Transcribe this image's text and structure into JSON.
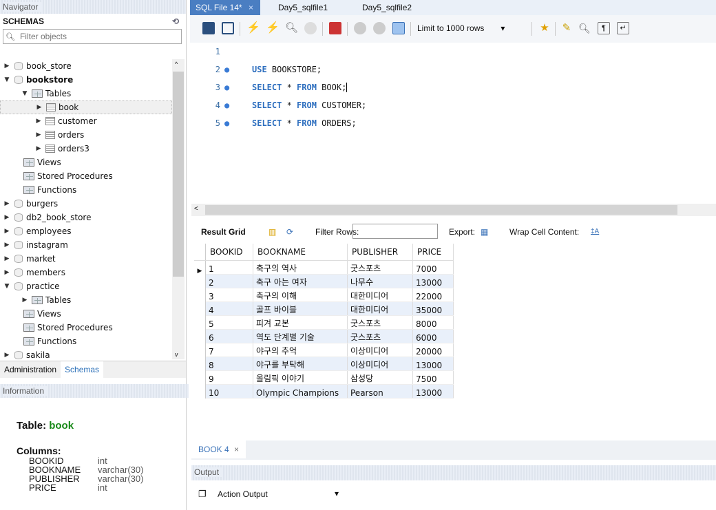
{
  "navigator": {
    "title": "Navigator",
    "schemas_label": "SCHEMAS",
    "filter_placeholder": "Filter objects",
    "tree": [
      {
        "label": "book_store",
        "level": 0,
        "type": "db",
        "expanded": false
      },
      {
        "label": "bookstore",
        "level": 0,
        "type": "db",
        "expanded": true,
        "bold": true
      },
      {
        "label": "Tables",
        "level": 1,
        "type": "folder",
        "expanded": true
      },
      {
        "label": "book",
        "level": 2,
        "type": "table",
        "selected": true
      },
      {
        "label": "customer",
        "level": 2,
        "type": "table"
      },
      {
        "label": "orders",
        "level": 2,
        "type": "table"
      },
      {
        "label": "orders3",
        "level": 2,
        "type": "table"
      },
      {
        "label": "Views",
        "level": 1,
        "type": "folder"
      },
      {
        "label": "Stored Procedures",
        "level": 1,
        "type": "folder"
      },
      {
        "label": "Functions",
        "level": 1,
        "type": "folder"
      },
      {
        "label": "burgers",
        "level": 0,
        "type": "db"
      },
      {
        "label": "db2_book_store",
        "level": 0,
        "type": "db"
      },
      {
        "label": "employees",
        "level": 0,
        "type": "db"
      },
      {
        "label": "instagram",
        "level": 0,
        "type": "db"
      },
      {
        "label": "market",
        "level": 0,
        "type": "db"
      },
      {
        "label": "members",
        "level": 0,
        "type": "db"
      },
      {
        "label": "practice",
        "level": 0,
        "type": "db",
        "expanded": true
      },
      {
        "label": "Tables",
        "level": 1,
        "type": "folder",
        "collapsed": true
      },
      {
        "label": "Views",
        "level": 1,
        "type": "folder"
      },
      {
        "label": "Stored Procedures",
        "level": 1,
        "type": "folder"
      },
      {
        "label": "Functions",
        "level": 1,
        "type": "folder"
      },
      {
        "label": "sakila",
        "level": 0,
        "type": "db"
      }
    ],
    "bottom_tabs": [
      "Administration",
      "Schemas"
    ],
    "information_title": "Information",
    "info": {
      "table_prefix": "Table:",
      "table_name": "book",
      "columns_label": "Columns:",
      "columns": [
        {
          "name": "BOOKID",
          "type": "int"
        },
        {
          "name": "BOOKNAME",
          "type": "varchar(30)"
        },
        {
          "name": "PUBLISHER",
          "type": "varchar(30)"
        },
        {
          "name": "PRICE",
          "type": "int"
        }
      ]
    }
  },
  "editor_tabs": [
    "SQL File 14*",
    "×",
    "Day5_sqlfile1",
    "Day5_sqlfile2"
  ],
  "toolbar": {
    "limit_label": "Limit to 1000 rows"
  },
  "editor": {
    "lines": [
      {
        "num": "1",
        "dot": "",
        "kw1": "",
        "text": ""
      },
      {
        "num": "2",
        "dot": "●",
        "kw1": "USE",
        "text": " BOOKSTORE;"
      },
      {
        "num": "3",
        "dot": "●",
        "kw1": "SELECT",
        "mid": " * ",
        "kw2": "FROM",
        "text": " BOOK;"
      },
      {
        "num": "4",
        "dot": "●",
        "kw1": "SELECT",
        "mid": " * ",
        "kw2": "FROM",
        "text": " CUSTOMER;"
      },
      {
        "num": "5",
        "dot": "●",
        "kw1": "SELECT",
        "mid": " * ",
        "kw2": "FROM",
        "text": " ORDERS;"
      }
    ]
  },
  "result_bar": {
    "result_grid": "Result Grid",
    "filter_rows": "Filter Rows:",
    "export": "Export:",
    "wrap": "Wrap Cell Content:"
  },
  "grid": {
    "columns": [
      "BOOKID",
      "BOOKNAME",
      "PUBLISHER",
      "PRICE"
    ],
    "rows": [
      [
        "1",
        "축구의 역사",
        "굿스포츠",
        "7000"
      ],
      [
        "2",
        "축구 아는 여자",
        "나무수",
        "13000"
      ],
      [
        "3",
        "축구의 이해",
        "대한미디어",
        "22000"
      ],
      [
        "4",
        "골프 바이블",
        "대한미디어",
        "35000"
      ],
      [
        "5",
        "피겨 교본",
        "굿스포츠",
        "8000"
      ],
      [
        "6",
        "역도 단계별 기술",
        "굿스포츠",
        "6000"
      ],
      [
        "7",
        "야구의 추억",
        "이상미디어",
        "20000"
      ],
      [
        "8",
        "야구를 부탁해",
        "이상미디어",
        "13000"
      ],
      [
        "9",
        "올림픽 이야기",
        "삼성당",
        "7500"
      ],
      [
        "10",
        "Olympic Champions",
        "Pearson",
        "13000"
      ]
    ]
  },
  "result_tab": "BOOK 4",
  "output_title": "Output",
  "action_output": "Action Output",
  "colors": {
    "accent": "#4a7ec2",
    "keyword": "#2e6fbf",
    "table_name": "#1a8a1a"
  }
}
